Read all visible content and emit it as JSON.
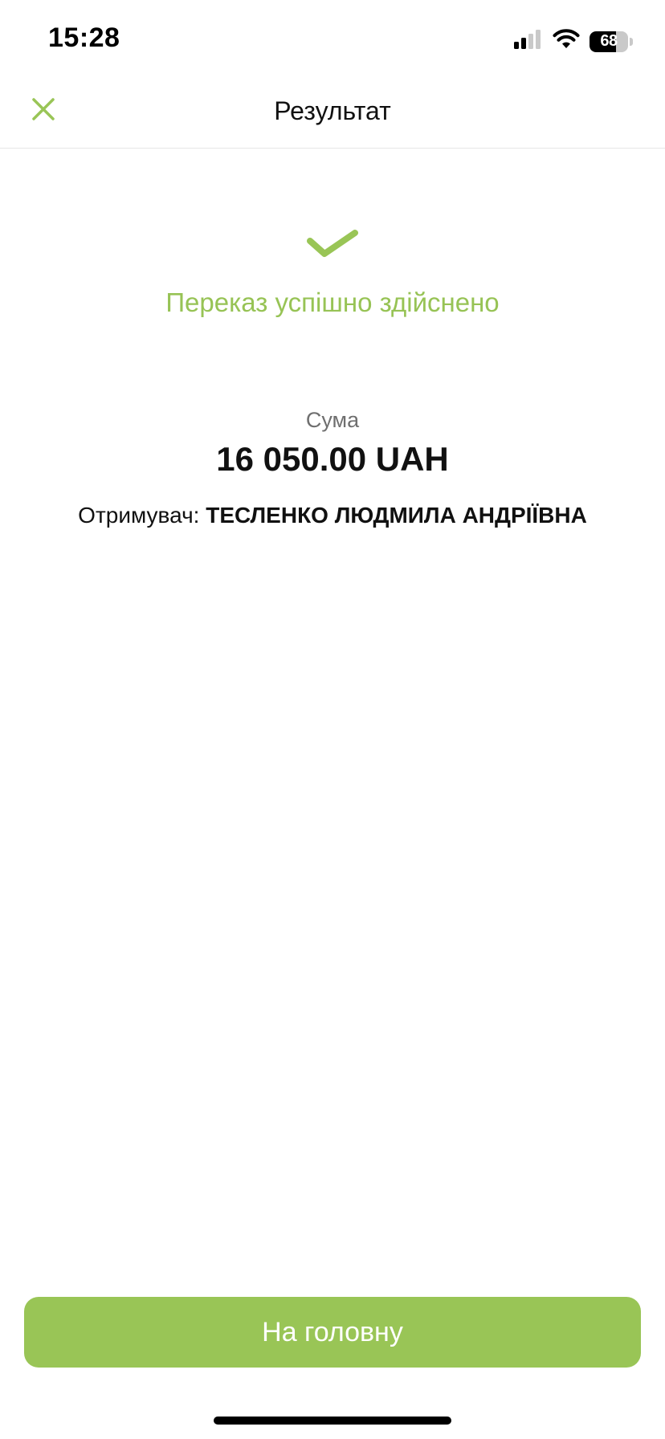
{
  "status_bar": {
    "time": "15:28",
    "battery_level": "68",
    "battery_fraction": 0.68,
    "signal_icon": "cellular-signal-icon",
    "wifi_icon": "wifi-icon",
    "battery_icon": "battery-icon"
  },
  "nav": {
    "title": "Результат",
    "close_icon": "close-icon"
  },
  "result": {
    "icon": "checkmark-icon",
    "message": "Переказ успішно здійснено"
  },
  "amount": {
    "label": "Сума",
    "value": "16 050.00 UAH"
  },
  "recipient": {
    "label": "Отримувач:",
    "name": "ТЕСЛЕНКО ЛЮДМИЛА АНДРІЇВНА"
  },
  "actions": {
    "home_label": "На головну"
  },
  "colors": {
    "accent": "#99c556",
    "success_text": "#97c355",
    "muted_text": "#6f6f6f"
  }
}
